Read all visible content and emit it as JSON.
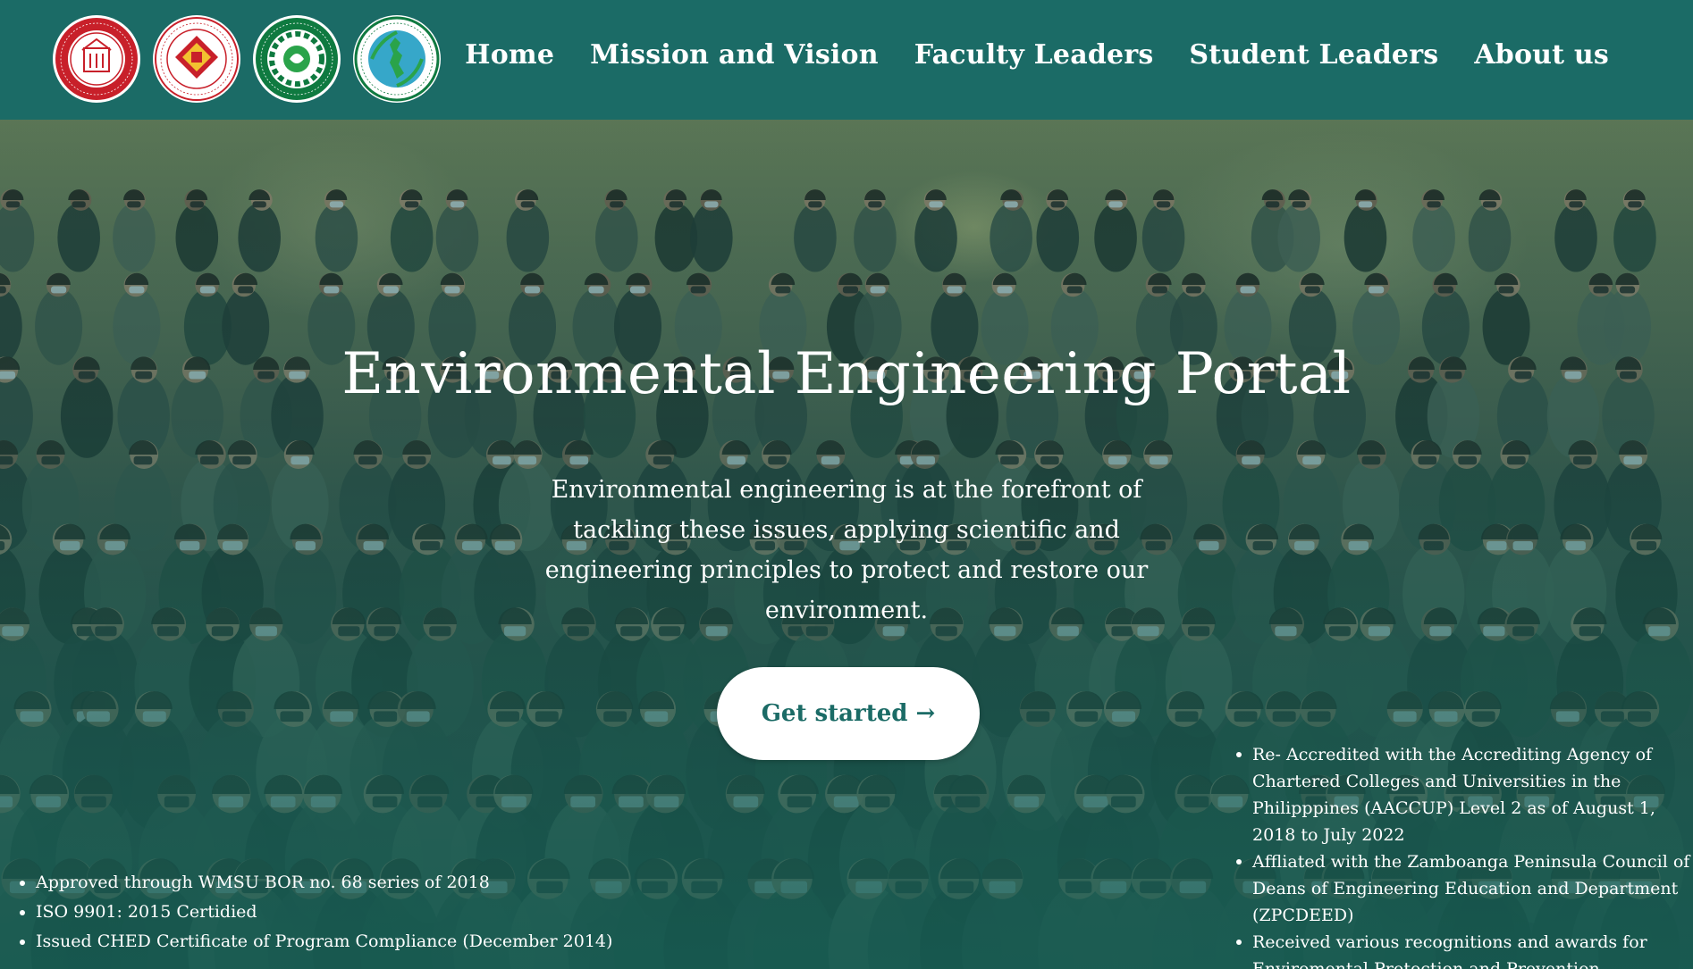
{
  "header": {
    "logos": [
      {
        "name": "wmsu-seal",
        "text": "WESTERN MINDANAO STATE UNIVERSITY",
        "color": "#c8202a"
      },
      {
        "name": "college-of-engineering-seal",
        "text": "COLLEGE OF ENGINEERING",
        "color": "#c8202a"
      },
      {
        "name": "environmental-engineering-dept-seal",
        "text": "DEPARTMENT OF ENVIRONMENTAL ENGINEERING",
        "color": "#1c8a3a"
      },
      {
        "name": "society-env-engineers-seal",
        "text": "SOCIETY OF ENVIRONMENTAL ENGINEERS OF THE PHILIPPINES",
        "color": "#1c8a3a"
      }
    ],
    "nav": [
      {
        "label": "Home"
      },
      {
        "label": "Mission and Vision"
      },
      {
        "label": "Faculty Leaders"
      },
      {
        "label": "Student Leaders"
      },
      {
        "label": "About us"
      }
    ]
  },
  "hero": {
    "title": "Environmental Engineering Portal",
    "subtitle": "Environmental engineering is at the forefront of tackling these issues, applying scientific and engineering principles to protect and restore our environment.",
    "cta_label": "Get started →",
    "left_list": [
      "Approved through WMSU BOR no. 68 series of 2018",
      "ISO 9901: 2015 Certidied",
      "Issued CHED Certificate of Program Compliance (December 2014)"
    ],
    "right_list": [
      "Re- Accredited with the Accrediting Agency of Chartered Colleges and Universities in the Philipppines (AACCUP) Level 2 as of August 1, 2018 to July 2022",
      "Affliated with the Zamboanga Peninsula Council of Deans of Engineering Education and Department (ZPCDEED)",
      "Received various recognitions and awards for Enviromental Protection and Prevention"
    ]
  },
  "colors": {
    "header_bg": "#1b6b66",
    "accent": "#1b6b66",
    "text_light": "#ffffff"
  }
}
